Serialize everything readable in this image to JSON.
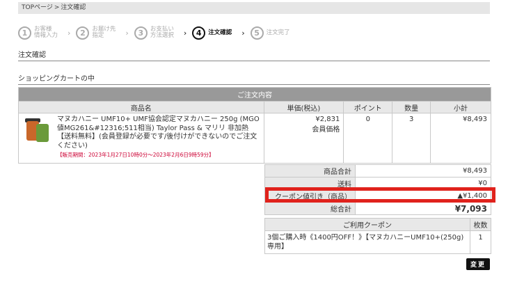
{
  "breadcrumb": {
    "home": "TOPページ",
    "sep": ">",
    "current": "注文確認"
  },
  "steps": [
    {
      "num": "1",
      "label": "お客様\n情報入力"
    },
    {
      "num": "2",
      "label": "お届け先\n指定"
    },
    {
      "num": "3",
      "label": "お支払い\n方法選択"
    },
    {
      "num": "4",
      "label": "注文確認"
    },
    {
      "num": "5",
      "label": "注文完了"
    }
  ],
  "arrow": "›",
  "section_title": "注文確認",
  "cart_title": "ショッピングカートの中",
  "cart": {
    "caption": "ご注文内容",
    "headers": {
      "name": "商品名",
      "price": "単価(税込)",
      "points": "ポイント",
      "qty": "数量",
      "subtotal": "小計"
    },
    "item": {
      "name": "マヌカハニー UMF10+ UMF協会認定マヌカハニー 250g (MGO値MG261&#12316;511相当) Taylor Pass & マリリ 非加熱 【送料無料】(会員登録が必要です/後付けができないのでご注文ください)",
      "period": "【販売期間：2023年1月27日10時0分～2023年2月6日9時59分】",
      "price": "¥2,831",
      "price_note": "会員価格",
      "points": "0",
      "qty": "3",
      "subtotal": "¥8,493"
    }
  },
  "summary": {
    "goods_total_label": "商品合計",
    "goods_total": "¥8,493",
    "shipping_label": "送料",
    "shipping": "¥0",
    "coupon_label": "クーポン値引き（商品）",
    "coupon": "▲¥1,400",
    "grand_total_label": "総合計",
    "grand_total": "¥7,093"
  },
  "coupon_table": {
    "header_name": "ご利用クーポン",
    "header_count": "枚数",
    "name": "3個ご購入時《1400円OFF！》【マヌカハニーUMF10+(250g)専用】",
    "count": "1"
  },
  "change_button": "変更",
  "colors": {
    "highlight": "#e0221c",
    "header_bg": "#999999"
  }
}
